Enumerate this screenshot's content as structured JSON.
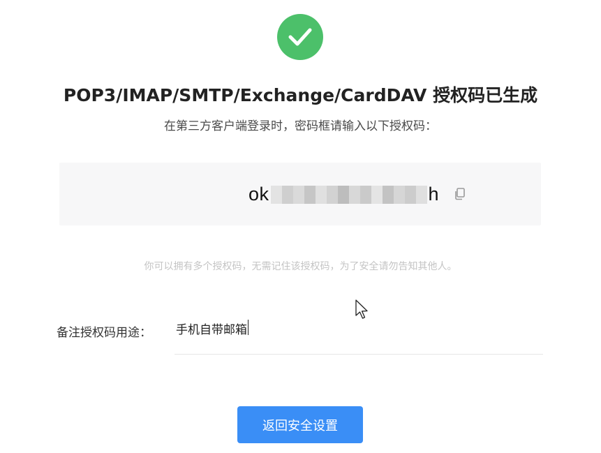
{
  "status": {
    "icon": "check-icon",
    "color": "#4cc06a"
  },
  "header": {
    "title": "POP3/IMAP/SMTP/Exchange/CardDAV 授权码已生成",
    "subtitle": "在第三方客户端登录时，密码框请输入以下授权码："
  },
  "auth_code": {
    "prefix": "ok",
    "suffix": "h",
    "masked": true,
    "copy_icon": "copy-icon"
  },
  "notice": "你可以拥有多个授权码，无需记住该授权码，为了安全请勿告知其他人。",
  "note": {
    "label": "备注授权码用途：",
    "value": "手机自带邮箱"
  },
  "actions": {
    "back_label": "返回安全设置",
    "button_color": "#3a8ef6"
  }
}
